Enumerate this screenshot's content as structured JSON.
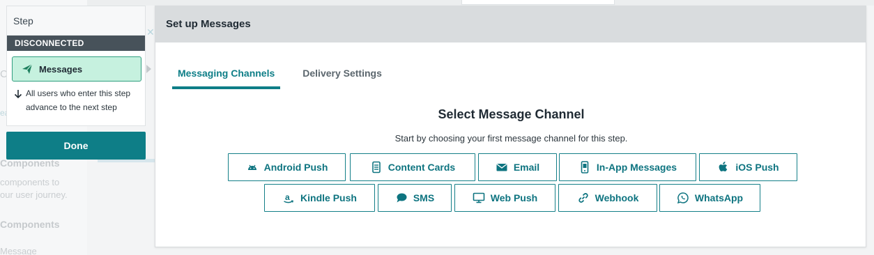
{
  "background": {
    "left_texts": [
      "Co",
      "ea",
      "Components",
      "components to",
      "our user journey.",
      "Components",
      "Message"
    ]
  },
  "step": {
    "title": "Step",
    "status": "DISCONNECTED",
    "message_label": "Messages",
    "message_icon": "paper-plane-icon",
    "advance_text_line1": "All users who enter this step",
    "advance_text_line2": "advance to the next step",
    "done_label": "Done"
  },
  "modal": {
    "title": "Set up Messages",
    "tabs": [
      {
        "label": "Messaging Channels",
        "active": true
      },
      {
        "label": "Delivery Settings",
        "active": false
      }
    ],
    "section_title": "Select Message Channel",
    "section_subtitle": "Start by choosing your first message channel for this step.",
    "channels_row1": [
      {
        "label": "Android Push",
        "icon": "android-icon"
      },
      {
        "label": "Content Cards",
        "icon": "content-cards-icon"
      },
      {
        "label": "Email",
        "icon": "envelope-icon"
      },
      {
        "label": "In-App Messages",
        "icon": "mobile-phone-icon"
      },
      {
        "label": "iOS Push",
        "icon": "apple-icon"
      }
    ],
    "channels_row2": [
      {
        "label": "Kindle Push",
        "icon": "amazon-icon"
      },
      {
        "label": "SMS",
        "icon": "chat-bubble-icon"
      },
      {
        "label": "Web Push",
        "icon": "monitor-icon"
      },
      {
        "label": "Webhook",
        "icon": "link-icon"
      },
      {
        "label": "WhatsApp",
        "icon": "whatsapp-icon"
      }
    ]
  },
  "colors": {
    "accent": "#0e7e87",
    "status_band": "#47525a",
    "message_pill_bg": "#c6f1df",
    "message_pill_border": "#2f9e7f",
    "modal_header": "#d9dcde"
  }
}
